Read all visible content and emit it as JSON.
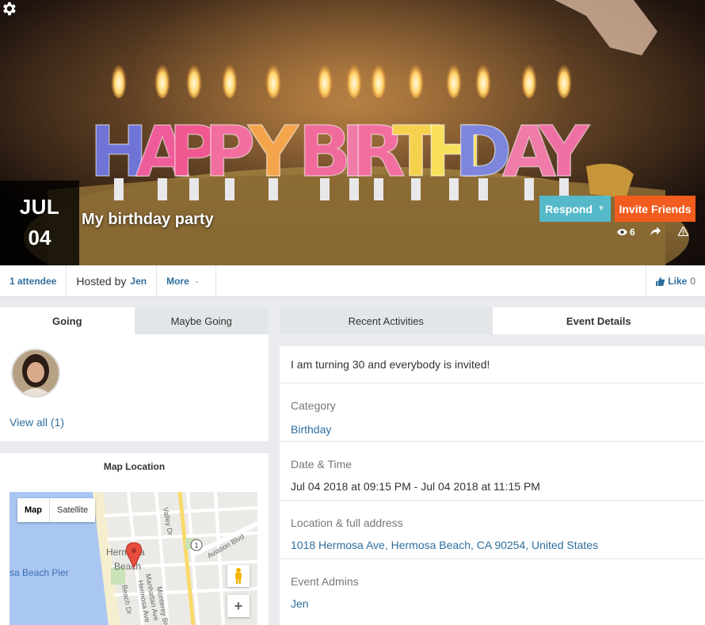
{
  "cover": {
    "candle_letters": [
      "H",
      "A",
      "P",
      "P",
      "Y",
      "B",
      "I",
      "R",
      "T",
      "H",
      "D",
      "A",
      "Y"
    ],
    "month": "JUL",
    "day": "04",
    "title": "My birthday party",
    "respond_label": "Respond",
    "invite_label": "Invite Friends",
    "views": "6"
  },
  "infobar": {
    "attendees": "1 attendee",
    "hosted_prefix": "Hosted by",
    "host": "Jen",
    "more_label": "More",
    "like_label": "Like",
    "like_count": "0"
  },
  "attendance": {
    "tab_going": "Going",
    "tab_maybe": "Maybe Going",
    "view_all": "View all (1)"
  },
  "map": {
    "title": "Map Location",
    "type_map": "Map",
    "type_satellite": "Satellite",
    "place_hermosa_line1": "Hermosa",
    "place_hermosa_line2": "Beach",
    "place_pier": "sa Beach Pier",
    "street_valley": "Valley Dr",
    "street_aviation": "Aviation Blvd",
    "street_manhattan": "Manhattan Ave",
    "street_hermosa_ave": "Hermosa Ave",
    "street_monterey": "Monterey Blvd",
    "street_beach": "Beach Dr",
    "route_shield": "1"
  },
  "event": {
    "tab_recent": "Recent Activities",
    "tab_details": "Event Details",
    "description": "I am turning 30 and everybody is invited!",
    "category_label": "Category",
    "category_value": "Birthday",
    "datetime_label": "Date & Time",
    "datetime_value": "Jul 04 2018 at 09:15 PM - Jul 04 2018 at 11:15 PM",
    "location_label": "Location & full address",
    "location_value": "1018 Hermosa Ave, Hermosa Beach, CA 90254, United States",
    "admins_label": "Event Admins",
    "admins_value": "Jen"
  },
  "colors": {
    "respond": "#55b9c9",
    "invite": "#f25c1e",
    "link": "#2f6e9e"
  }
}
